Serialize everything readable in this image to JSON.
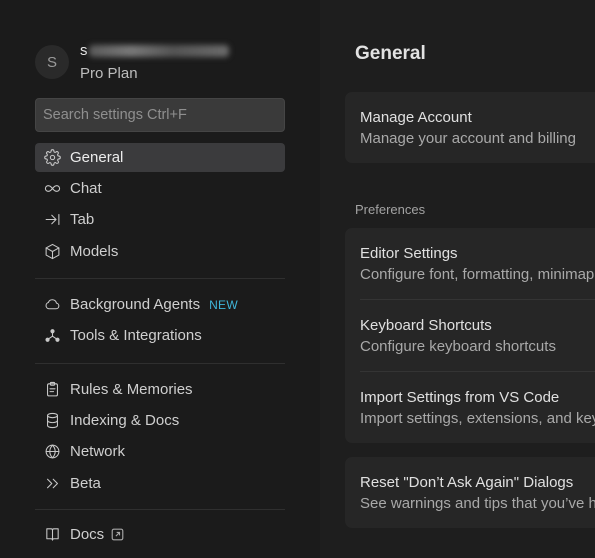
{
  "profile": {
    "avatar_initial": "S",
    "email_prefix": "s",
    "plan": "Pro Plan"
  },
  "search": {
    "placeholder": "Search settings Ctrl+F"
  },
  "nav": {
    "general": {
      "label": "General",
      "icon": "gear-icon",
      "active": true
    },
    "chat": {
      "label": "Chat",
      "icon": "infinity-icon"
    },
    "tab": {
      "label": "Tab",
      "icon": "arrow-to-line-icon"
    },
    "models": {
      "label": "Models",
      "icon": "cube-icon"
    },
    "background_agents": {
      "label": "Background Agents",
      "icon": "cloud-icon",
      "badge": "NEW"
    },
    "tools": {
      "label": "Tools & Integrations",
      "icon": "nodes-icon"
    },
    "rules": {
      "label": "Rules & Memories",
      "icon": "clipboard-icon"
    },
    "indexing": {
      "label": "Indexing & Docs",
      "icon": "database-icon"
    },
    "network": {
      "label": "Network",
      "icon": "globe-icon"
    },
    "beta": {
      "label": "Beta",
      "icon": "double-chevron-right-icon"
    },
    "docs": {
      "label": "Docs",
      "icon": "book-icon",
      "trailing_icon": "external-link-icon"
    }
  },
  "main": {
    "title": "General",
    "account": {
      "title": "Manage Account",
      "desc": "Manage your account and billing"
    },
    "preferences_label": "Preferences",
    "preferences": [
      {
        "title": "Editor Settings",
        "desc": "Configure font, formatting, minimap"
      },
      {
        "title": "Keyboard Shortcuts",
        "desc": "Configure keyboard shortcuts"
      },
      {
        "title": "Import Settings from VS Code",
        "desc": "Import settings, extensions, and key"
      }
    ],
    "reset": {
      "title": "Reset \"Don’t Ask Again\" Dialogs",
      "desc": "See warnings and tips that you’ve h"
    }
  },
  "colors": {
    "background": "#1e1e1e",
    "sidebar": "#1b1b1b",
    "active_item": "#3b3b3d",
    "card": "#262626",
    "badge": "#3fb5d9"
  }
}
